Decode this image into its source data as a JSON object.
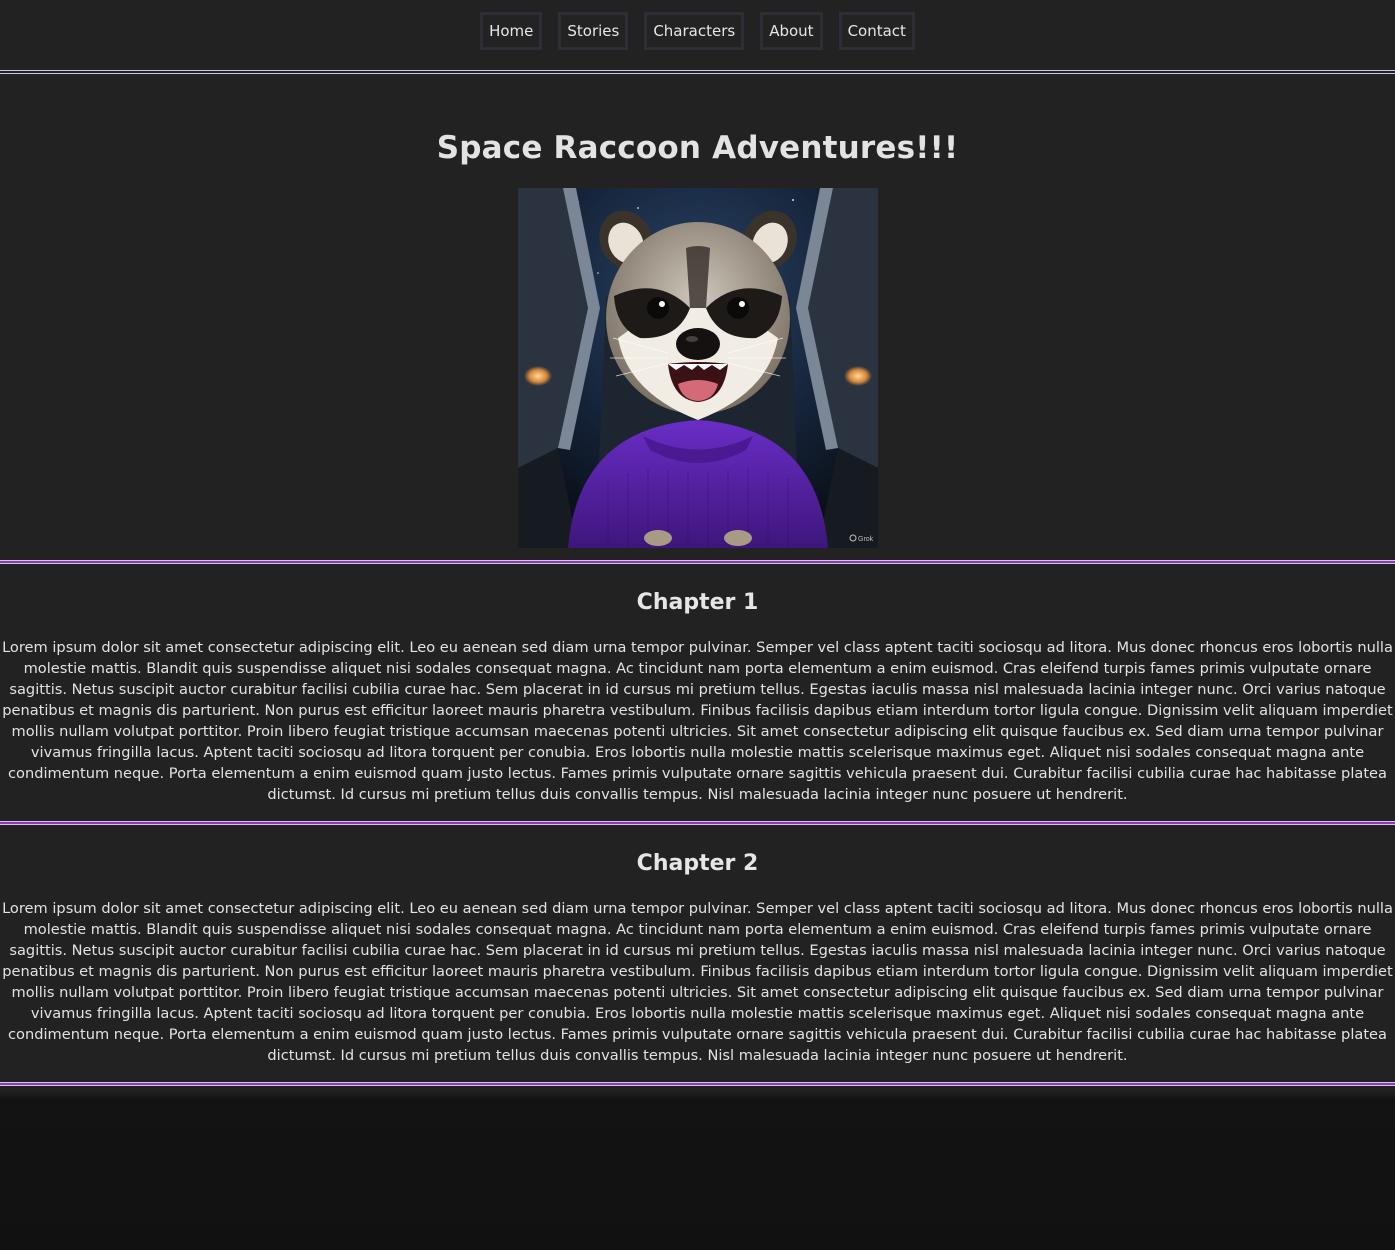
{
  "nav": {
    "items": [
      {
        "label": "Home"
      },
      {
        "label": "Stories"
      },
      {
        "label": "Characters"
      },
      {
        "label": "About"
      },
      {
        "label": "Contact"
      }
    ]
  },
  "hero": {
    "title": "Space Raccoon Adventures!!!",
    "image_watermark": "Grok"
  },
  "chapters": [
    {
      "title": "Chapter 1",
      "text": "Lorem ipsum dolor sit amet consectetur adipiscing elit. Leo eu aenean sed diam urna tempor pulvinar. Semper vel class aptent taciti sociosqu ad litora. Mus donec rhoncus eros lobortis nulla molestie mattis. Blandit quis suspendisse aliquet nisi sodales consequat magna. Ac tincidunt nam porta elementum a enim euismod. Cras eleifend turpis fames primis vulputate ornare sagittis. Netus suscipit auctor curabitur facilisi cubilia curae hac. Sem placerat in id cursus mi pretium tellus. Egestas iaculis massa nisl malesuada lacinia integer nunc. Orci varius natoque penatibus et magnis dis parturient. Non purus est efficitur laoreet mauris pharetra vestibulum. Finibus facilisis dapibus etiam interdum tortor ligula congue. Dignissim velit aliquam imperdiet mollis nullam volutpat porttitor. Proin libero feugiat tristique accumsan maecenas potenti ultricies. Sit amet consectetur adipiscing elit quisque faucibus ex. Sed diam urna tempor pulvinar vivamus fringilla lacus. Aptent taciti sociosqu ad litora torquent per conubia. Eros lobortis nulla molestie mattis scelerisque maximus eget. Aliquet nisi sodales consequat magna ante condimentum neque. Porta elementum a enim euismod quam justo lectus. Fames primis vulputate ornare sagittis vehicula praesent dui. Curabitur facilisi cubilia curae hac habitasse platea dictumst. Id cursus mi pretium tellus duis convallis tempus. Nisl malesuada lacinia integer nunc posuere ut hendrerit."
    },
    {
      "title": "Chapter 2",
      "text": "Lorem ipsum dolor sit amet consectetur adipiscing elit. Leo eu aenean sed diam urna tempor pulvinar. Semper vel class aptent taciti sociosqu ad litora. Mus donec rhoncus eros lobortis nulla molestie mattis. Blandit quis suspendisse aliquet nisi sodales consequat magna. Ac tincidunt nam porta elementum a enim euismod. Cras eleifend turpis fames primis vulputate ornare sagittis. Netus suscipit auctor curabitur facilisi cubilia curae hac. Sem placerat in id cursus mi pretium tellus. Egestas iaculis massa nisl malesuada lacinia integer nunc. Orci varius natoque penatibus et magnis dis parturient. Non purus est efficitur laoreet mauris pharetra vestibulum. Finibus facilisis dapibus etiam interdum tortor ligula congue. Dignissim velit aliquam imperdiet mollis nullam volutpat porttitor. Proin libero feugiat tristique accumsan maecenas potenti ultricies. Sit amet consectetur adipiscing elit quisque faucibus ex. Sed diam urna tempor pulvinar vivamus fringilla lacus. Aptent taciti sociosqu ad litora torquent per conubia. Eros lobortis nulla molestie mattis scelerisque maximus eget. Aliquet nisi sodales consequat magna ante condimentum neque. Porta elementum a enim euismod quam justo lectus. Fames primis vulputate ornare sagittis vehicula praesent dui. Curabitur facilisi cubilia curae hac habitasse platea dictumst. Id cursus mi pretium tellus duis convallis tempus. Nisl malesuada lacinia integer nunc posuere ut hendrerit."
    }
  ],
  "colors": {
    "background": "#222222",
    "footer_background": "#111111",
    "accent_separator": "#8c3ab0",
    "nav_border": "#2c2f36",
    "text": "#e4e4e4"
  }
}
